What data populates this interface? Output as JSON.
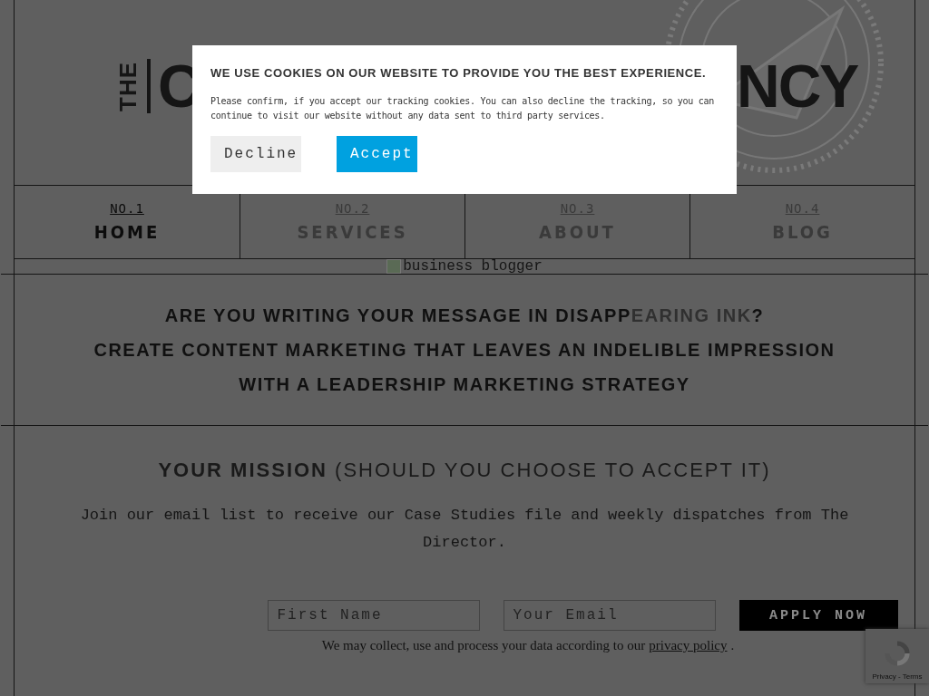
{
  "logo": {
    "vertical": "THE",
    "left": "C",
    "right": "NCY"
  },
  "nav": [
    {
      "number": "NO.1",
      "label": "HOME",
      "selected": true
    },
    {
      "number": "NO.2",
      "label": "SERVICES",
      "selected": false
    },
    {
      "number": "NO.3",
      "label": "ABOUT",
      "selected": false
    },
    {
      "number": "NO.4",
      "label": "BLOG",
      "selected": false
    }
  ],
  "banner_image": {
    "alt": "business blogger"
  },
  "headline": {
    "line_1": [
      {
        "text": "ARE YOU WRITING YOUR MESSAGE IN DISAPP",
        "faded": false
      },
      {
        "text": "EARING INK",
        "faded": true
      },
      {
        "text": "?",
        "faded": false
      }
    ],
    "line_2": "CREATE CONTENT MARKETING THAT LEAVES AN INDELIBLE IMPRESSION",
    "line_3": "WITH A LEADERSHIP MARKETING STRATEGY"
  },
  "mission": {
    "title": "**YOUR MISSION** (SHOULD YOU CHOOSE TO ACCEPT IT)",
    "text": "Join our email list to receive our Case Studies file and weekly dispatches from The Director.",
    "fields": [
      {
        "placeholder": "First Name"
      },
      {
        "placeholder": "Your Email"
      }
    ],
    "button": "APPLY NOW",
    "note": "We may collect, use and process your data according to our",
    "note_link": "privacy policy",
    "note_end": "."
  },
  "recaptcha": {
    "links": "Privacy - Terms"
  },
  "cookie_dialog": {
    "title": "WE USE COOKIES ON OUR WEBSITE TO PROVIDE YOU THE BEST EXPERIENCE.",
    "text": "Please confirm, if you accept our tracking cookies. You can also decline the tracking, so you can continue to visit our website without any data sent to third party services.",
    "buttons": [
      {
        "label": "Decline",
        "kind": "secondary"
      },
      {
        "label": "Accept",
        "kind": "primary"
      }
    ]
  }
}
